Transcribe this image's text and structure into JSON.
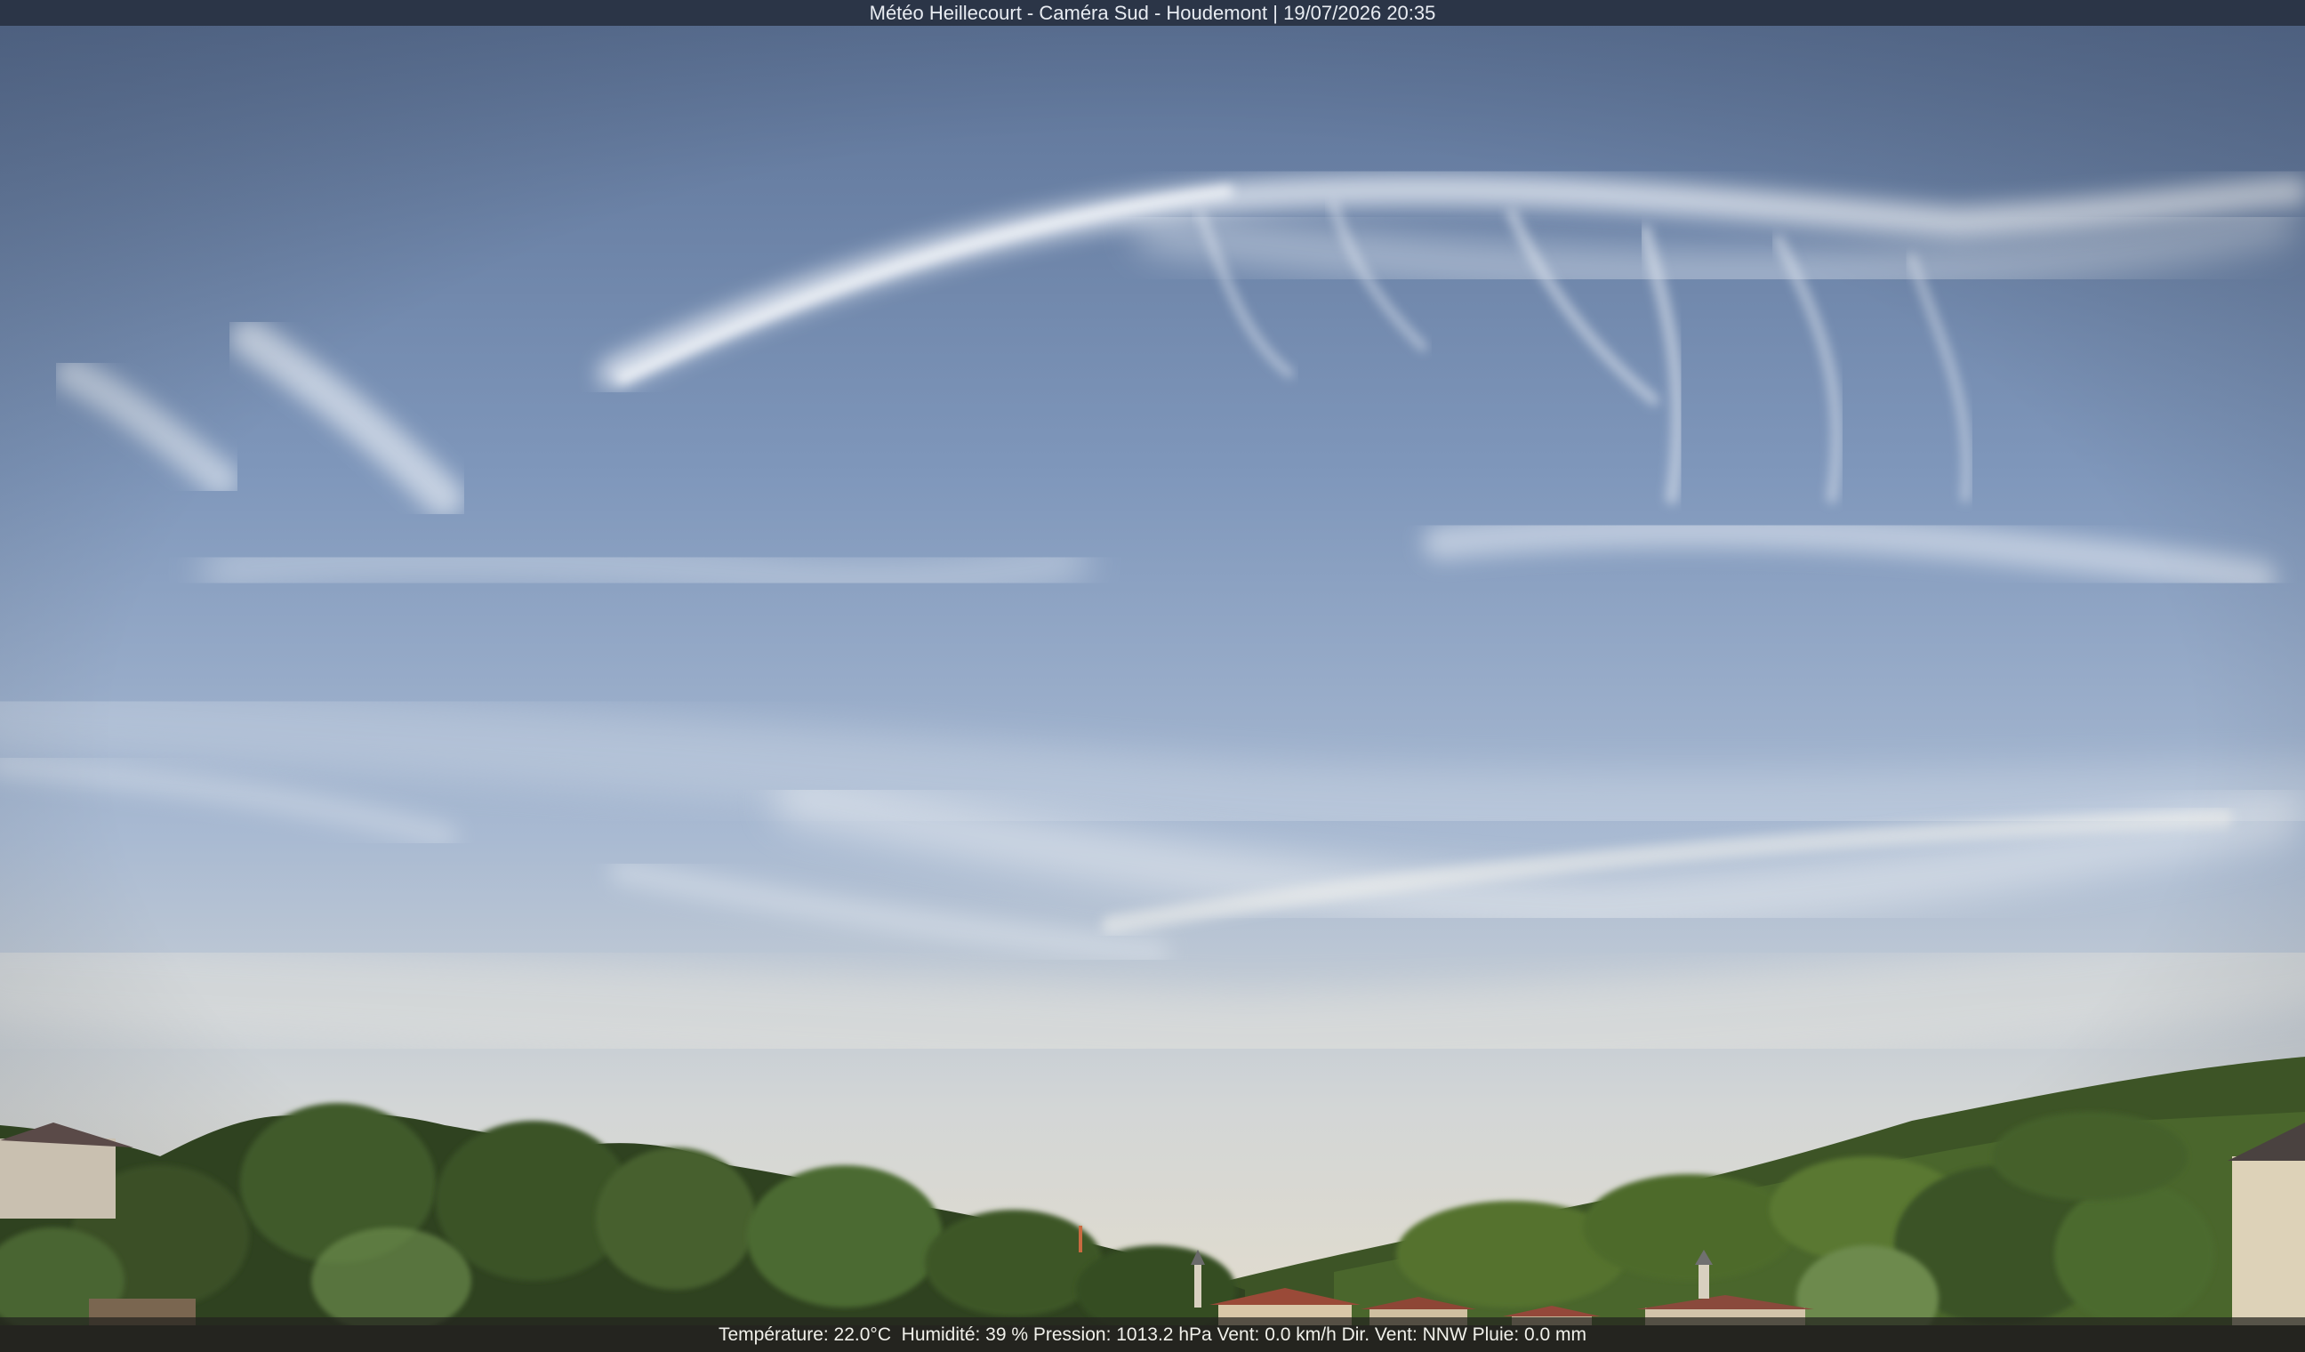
{
  "overlay": {
    "title": "Météo Heillecourt - Caméra Sud - Houdemont | 19/07/2026 20:35",
    "status_line": "Température: 22.0°C  Humidité: 39 % Pression: 1013.2 hPa Vent: 0.0 km/h Dir. Vent: NNW Pluie: 0.0 mm"
  },
  "palette": {
    "sky_top": "#5f7598",
    "sky_mid": "#8fa6c6",
    "sky_horizon": "#dcd8cc",
    "cloud": "#e6ebf2",
    "foliage_dark": "#2c3d1f",
    "foliage_light": "#5d7a36",
    "roof": "#9a4a38"
  }
}
